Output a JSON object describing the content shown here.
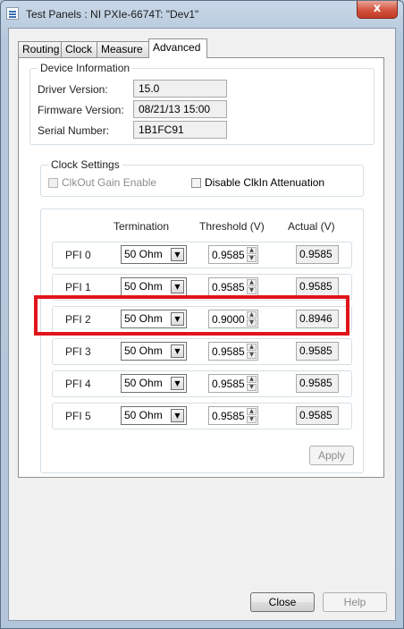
{
  "window": {
    "title": "Test Panels : NI PXIe-6674T: \"Dev1\"",
    "close_glyph": "x"
  },
  "tabs": [
    {
      "label": "Routing",
      "active": false
    },
    {
      "label": "Clock",
      "active": false
    },
    {
      "label": "Measure",
      "active": false
    },
    {
      "label": "Advanced",
      "active": true
    }
  ],
  "device_info": {
    "legend": "Device Information",
    "driver_label": "Driver Version:",
    "driver_value": "15.0",
    "firmware_label": "Firmware Version:",
    "firmware_value": "08/21/13 15:00",
    "serial_label": "Serial Number:",
    "serial_value": "1B1FC91"
  },
  "clock_settings": {
    "legend": "Clock Settings",
    "clkout_gain_label": "ClkOut Gain Enable",
    "clkout_gain_checked": false,
    "disable_clkin_label": "Disable ClkIn Attenuation",
    "disable_clkin_checked": false
  },
  "pfi_table": {
    "headers": {
      "termination": "Termination",
      "threshold": "Threshold (V)",
      "actual": "Actual (V)"
    },
    "rows": [
      {
        "label": "PFI 0",
        "termination": "50 Ohm",
        "threshold": "0.9585",
        "actual": "0.9585"
      },
      {
        "label": "PFI 1",
        "termination": "50 Ohm",
        "threshold": "0.9585",
        "actual": "0.9585"
      },
      {
        "label": "PFI 2",
        "termination": "50 Ohm",
        "threshold": "0.9000",
        "actual": "0.8946"
      },
      {
        "label": "PFI 3",
        "termination": "50 Ohm",
        "threshold": "0.9585",
        "actual": "0.9585"
      },
      {
        "label": "PFI 4",
        "termination": "50 Ohm",
        "threshold": "0.9585",
        "actual": "0.9585"
      },
      {
        "label": "PFI 5",
        "termination": "50 Ohm",
        "threshold": "0.9585",
        "actual": "0.9585"
      }
    ]
  },
  "buttons": {
    "apply": "Apply",
    "close": "Close",
    "help": "Help"
  },
  "colors": {
    "highlight": "#e0151b"
  }
}
